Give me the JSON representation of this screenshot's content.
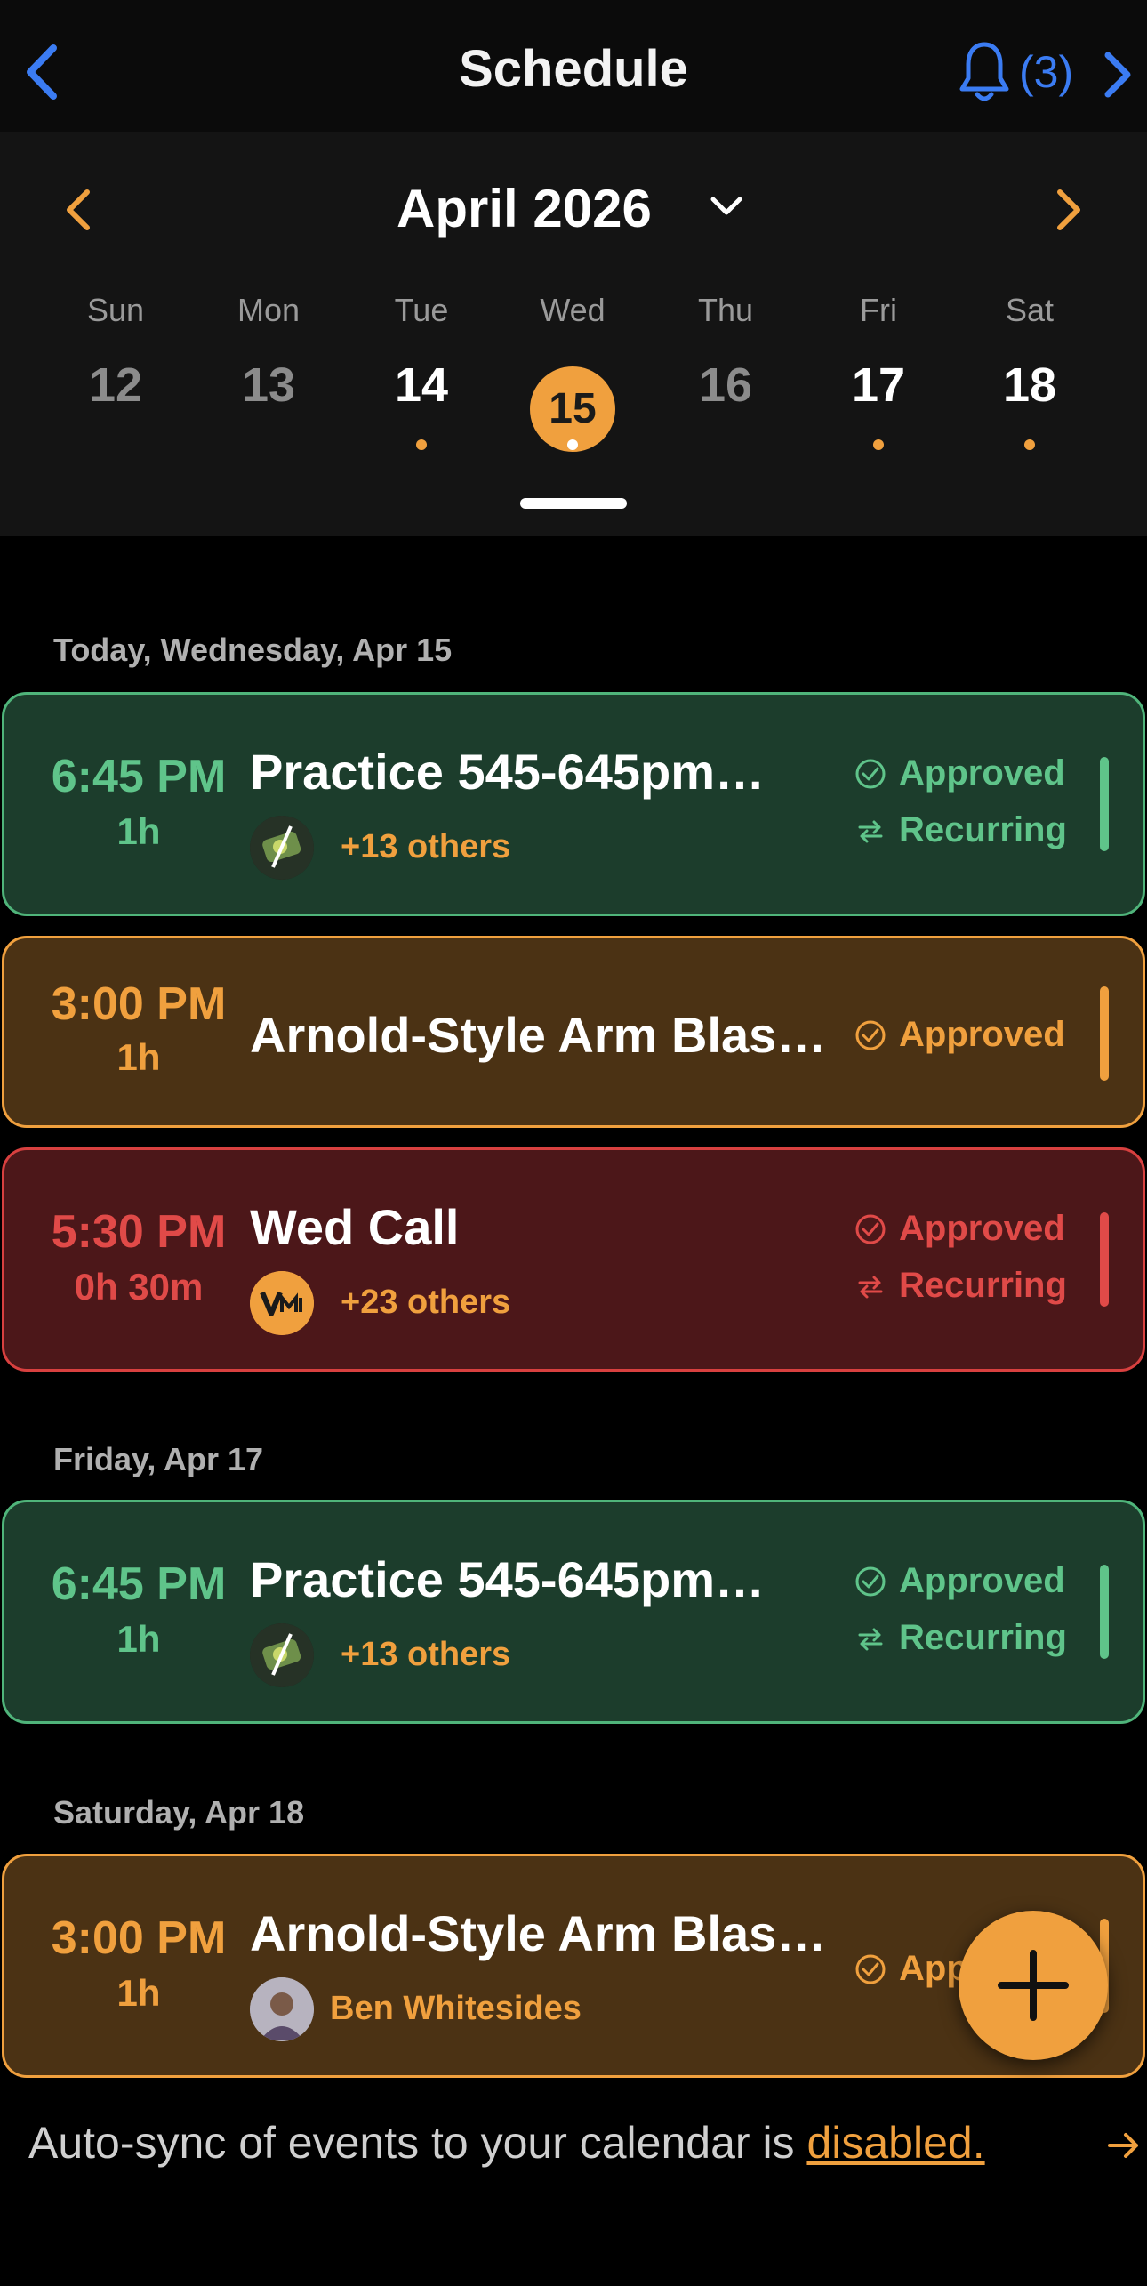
{
  "header": {
    "title": "Schedule",
    "notification_count": "(3)",
    "icons": [
      "chevron-left-icon",
      "bell-icon",
      "chevron-right-icon"
    ]
  },
  "calendar": {
    "month_label": "April 2026",
    "weekdays": [
      "Sun",
      "Mon",
      "Tue",
      "Wed",
      "Thu",
      "Fri",
      "Sat"
    ],
    "days": [
      "12",
      "13",
      "14",
      "15",
      "16",
      "17",
      "18"
    ],
    "selected_day": "15",
    "days_with_events": [
      "14",
      "15",
      "17",
      "18"
    ]
  },
  "sections": [
    {
      "label": "Today, Wednesday, Apr 15",
      "events": [
        {
          "color": "green",
          "time": "6:45 PM",
          "duration": "1h",
          "title": "Practice 545-645pm…",
          "attendees": "+13 others",
          "statuses": [
            "Approved",
            "Recurring"
          ]
        },
        {
          "color": "orange",
          "time": "3:00 PM",
          "duration": "1h",
          "title": "Arnold-Style Arm Blas…",
          "attendees": "",
          "statuses": [
            "Approved"
          ]
        },
        {
          "color": "red",
          "time": "5:30 PM",
          "duration": "0h 30m",
          "title": "Wed Call",
          "attendees": "+23 others",
          "statuses": [
            "Approved",
            "Recurring"
          ]
        }
      ]
    },
    {
      "label": "Friday, Apr 17",
      "events": [
        {
          "color": "green",
          "time": "6:45 PM",
          "duration": "1h",
          "title": "Practice 545-645pm…",
          "attendees": "+13 others",
          "statuses": [
            "Approved",
            "Recurring"
          ]
        }
      ]
    },
    {
      "label": "Saturday, Apr 18",
      "events": [
        {
          "color": "orange",
          "time": "3:00 PM",
          "duration": "1h",
          "title": "Arnold-Style Arm Blas…",
          "attendees": "Ben Whitesides",
          "statuses": [
            "App"
          ]
        }
      ]
    }
  ],
  "footer": {
    "sync_text": "Auto-sync of events to your calendar is ",
    "sync_link": "disabled."
  },
  "colors": {
    "accent_orange": "#f0a03e",
    "accent_blue": "#3b7cf3",
    "green": "#5fc48a",
    "red": "#e04a48"
  }
}
